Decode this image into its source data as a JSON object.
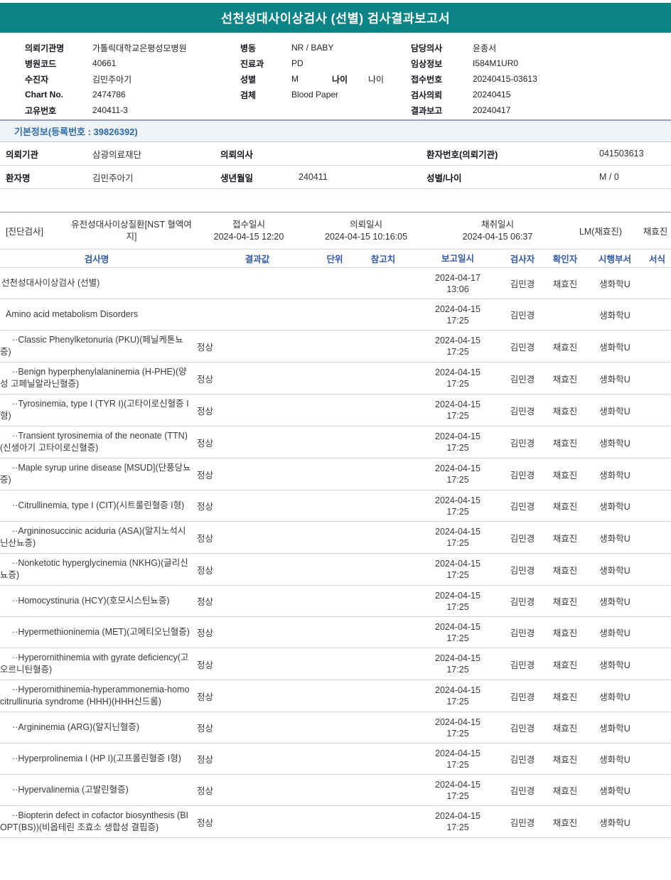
{
  "title": "선천성대사이상검사 (선별) 검사결과보고서",
  "colors": {
    "banner-bg": "#0a8486",
    "header-blue": "#3258a8",
    "section-blue": "#2d6ca8",
    "line-dark": "#97a2ae",
    "line-light": "#ccd3da",
    "bar-bg": "#eff3f7",
    "text-dark": "#14141e"
  },
  "patient_header": {
    "col1": [
      {
        "label": "의뢰기관명",
        "value": "가톨릭대학교은평성모병원"
      },
      {
        "label": "병원코드",
        "value": "40661"
      },
      {
        "label": "수진자",
        "value": "김민주아기"
      },
      {
        "label": "Chart No.",
        "value": "2474786"
      },
      {
        "label": "고유번호",
        "value": "240411-3"
      }
    ],
    "col2": [
      {
        "label": "병동",
        "value": "NR / BABY"
      },
      {
        "label": "진료과",
        "value": "PD"
      },
      {
        "label": "성별",
        "value": "M",
        "extra_label": "나이",
        "extra_value": "나이"
      },
      {
        "label": "검체",
        "value": "Blood Paper"
      }
    ],
    "col3": [
      {
        "label": "담당의사",
        "value": "윤종서"
      },
      {
        "label": "임상정보",
        "value": "I584M1UR0"
      },
      {
        "label": "접수번호",
        "value": "20240415-03613"
      },
      {
        "label": "검사의뢰",
        "value": "20240415"
      },
      {
        "label": "결과보고",
        "value": "20240417"
      }
    ]
  },
  "basic_info": {
    "heading": "기본정보(등록번호 : 39826392)",
    "rows": [
      [
        {
          "label": "의뢰기관",
          "value": "삼광의료재단"
        },
        {
          "label": "의뢰의사",
          "value": ""
        },
        {
          "label": "환자번호(의뢰기관)",
          "value": "041503613"
        }
      ],
      [
        {
          "label": "환자명",
          "value": "김민주아기"
        },
        {
          "label": "생년월일",
          "value": "240411"
        },
        {
          "label": "성별/나이",
          "value": "M / 0"
        }
      ]
    ]
  },
  "diagnostic": {
    "section_label": "[진단검사]",
    "test_group": "유전성대사이상질환[NST 혈액여지]",
    "receipt_label": "접수일시",
    "receipt_value": "2024-04-15 12:20",
    "request_label": "의뢰일시",
    "request_value": "2024-04-15 10:16:05",
    "collect_label": "채취일시",
    "collect_value": "2024-04-15 06:37",
    "collector": "LM(채효진)",
    "collector2": "채효진"
  },
  "results": {
    "headers": [
      "검사명",
      "결과값",
      "단위",
      "참고치",
      "보고일시",
      "검사자",
      "확인자",
      "시행부서",
      "서식"
    ],
    "rows": [
      {
        "name": "선천성대사이상검사 (선별)",
        "indent": 0,
        "result": "",
        "date": "2024-04-17",
        "time": "13:06",
        "tester": "김민경",
        "verifier": "채효진",
        "dept": "생화학U"
      },
      {
        "name": "Amino acid metabolism Disorders",
        "indent": 1,
        "result": "",
        "date": "2024-04-15",
        "time": "17:25",
        "tester": "김민경",
        "verifier": "",
        "dept": "생화학U"
      },
      {
        "name": "··Classic Phenylketonuria (PKU)(페닐케톤뇨증)",
        "indent": 2,
        "result": "정상",
        "date": "2024-04-15",
        "time": "17:25",
        "tester": "김민경",
        "verifier": "채효진",
        "dept": "생화학U"
      },
      {
        "name": "··Benign hyperphenylalaninemia (H-PHE)(양성 고페닐알라닌혈증)",
        "indent": 2,
        "result": "정상",
        "date": "2024-04-15",
        "time": "17:25",
        "tester": "김민경",
        "verifier": "채효진",
        "dept": "생화학U"
      },
      {
        "name": "··Tyrosinemia, type I (TYR I)(고타이로신혈증 I형)",
        "indent": 2,
        "result": "정상",
        "date": "2024-04-15",
        "time": "17:25",
        "tester": "김민경",
        "verifier": "채효진",
        "dept": "생화학U"
      },
      {
        "name": "··Transient tyrosinemia of the neonate (TTN)(신생아기 고타이로신혈증)",
        "indent": 2,
        "result": "정상",
        "date": "2024-04-15",
        "time": "17:25",
        "tester": "김민경",
        "verifier": "채효진",
        "dept": "생화학U"
      },
      {
        "name": "··Maple syrup urine disease [MSUD](단풍당뇨증)",
        "indent": 2,
        "result": "정상",
        "date": "2024-04-15",
        "time": "17:25",
        "tester": "김민경",
        "verifier": "채효진",
        "dept": "생화학U"
      },
      {
        "name": "··Citrullinemia, type I (CIT)(시트룰린혈증 I형)",
        "indent": 2,
        "result": "정상",
        "date": "2024-04-15",
        "time": "17:25",
        "tester": "김민경",
        "verifier": "채효진",
        "dept": "생화학U"
      },
      {
        "name": "··Argininosuccinic aciduria (ASA)(알지노석시닌산뇨증)",
        "indent": 2,
        "result": "정상",
        "date": "2024-04-15",
        "time": "17:25",
        "tester": "김민경",
        "verifier": "채효진",
        "dept": "생화학U"
      },
      {
        "name": "··Nonketotic hyperglycinemia (NKHG)(글리신뇨증)",
        "indent": 2,
        "result": "정상",
        "date": "2024-04-15",
        "time": "17:25",
        "tester": "김민경",
        "verifier": "채효진",
        "dept": "생화학U"
      },
      {
        "name": "··Homocystinuria (HCY)(호모시스틴뇨증)",
        "indent": 2,
        "result": "정상",
        "date": "2024-04-15",
        "time": "17:25",
        "tester": "김민경",
        "verifier": "채효진",
        "dept": "생화학U"
      },
      {
        "name": "··Hypermethioninemia (MET)(고메티오닌혈증)",
        "indent": 2,
        "result": "정상",
        "date": "2024-04-15",
        "time": "17:25",
        "tester": "김민경",
        "verifier": "채효진",
        "dept": "생화학U"
      },
      {
        "name": "··Hyperornithinemia with gyrate deficiency(고오르니틴혈증)",
        "indent": 2,
        "result": "정상",
        "date": "2024-04-15",
        "time": "17:25",
        "tester": "김민경",
        "verifier": "채효진",
        "dept": "생화학U"
      },
      {
        "name": "··Hyperornithinemia-hyperammonemia-homocitrullinuria syndrome (HHH)(HHH신드롬)",
        "indent": 2,
        "result": "정상",
        "date": "2024-04-15",
        "time": "17:25",
        "tester": "김민경",
        "verifier": "채효진",
        "dept": "생화학U"
      },
      {
        "name": "··Argininemia (ARG)(알지닌혈증)",
        "indent": 2,
        "result": "정상",
        "date": "2024-04-15",
        "time": "17:25",
        "tester": "김민경",
        "verifier": "채효진",
        "dept": "생화학U"
      },
      {
        "name": "··Hyperprolinemia I (HP I)(고프롤린혈증 I형)",
        "indent": 2,
        "result": "정상",
        "date": "2024-04-15",
        "time": "17:25",
        "tester": "김민경",
        "verifier": "채효진",
        "dept": "생화학U"
      },
      {
        "name": "··Hypervalinemia (고발린혈증)",
        "indent": 2,
        "result": "정상",
        "date": "2024-04-15",
        "time": "17:25",
        "tester": "김민경",
        "verifier": "채효진",
        "dept": "생화학U"
      },
      {
        "name": "··Biopterin defect in cofactor biosynthesis (BIOPT(BS))(비옵테린 조효소 생합성 결핍증)",
        "indent": 2,
        "result": "정상",
        "date": "2024-04-15",
        "time": "17:25",
        "tester": "김민경",
        "verifier": "채효진",
        "dept": "생화학U"
      }
    ]
  }
}
